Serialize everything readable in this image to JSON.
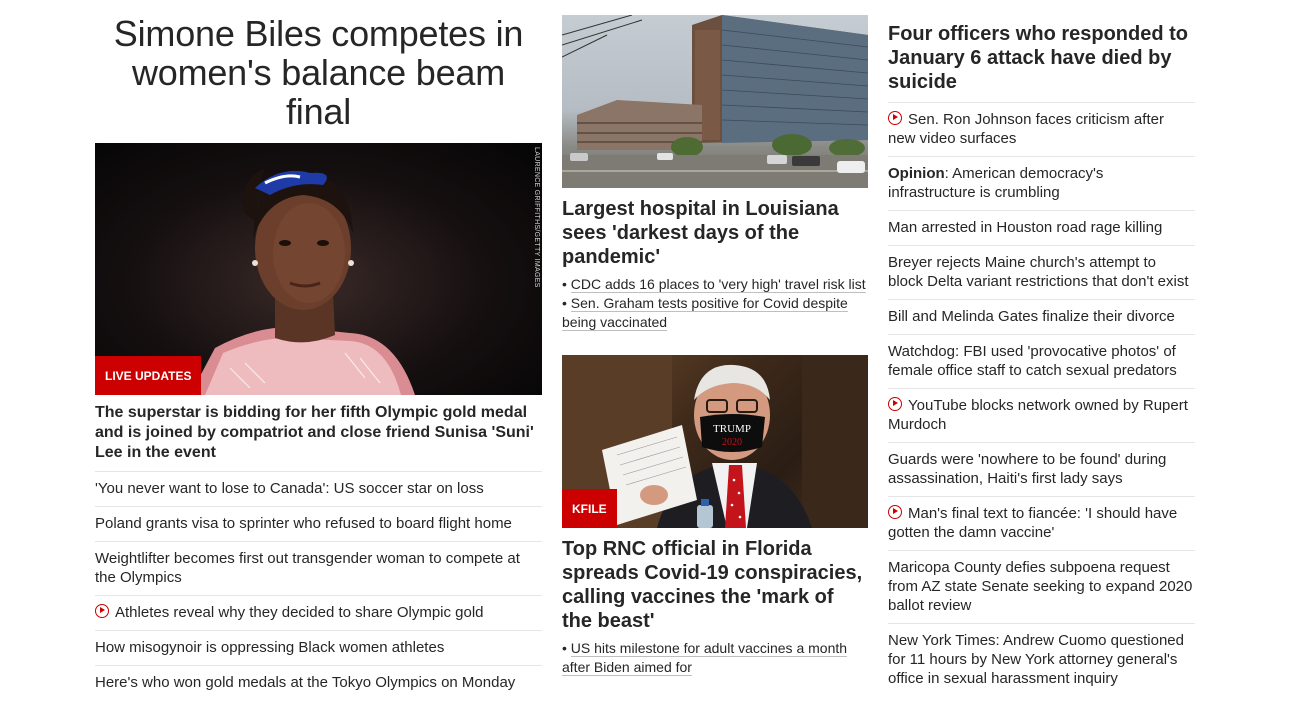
{
  "col1": {
    "title": "Simone Biles competes in women's balance beam final",
    "image_credit": "LAURENCE GRIFFITHS/GETTY IMAGES",
    "badge": "LIVE UPDATES",
    "subheadline": "The superstar is bidding for her fifth Olympic gold medal and is joined by compatriot and close friend Sunisa 'Suni' Lee in the event",
    "items": [
      {
        "text": "'You never want to lose to Canada': US soccer star on loss",
        "video": false
      },
      {
        "text": "Poland grants visa to sprinter who refused to board flight home",
        "video": false
      },
      {
        "text": "Weightlifter becomes first out transgender woman to compete at the Olympics",
        "video": false
      },
      {
        "text": "Athletes reveal why they decided to share Olympic gold",
        "video": true
      },
      {
        "text": "How misogynoir is oppressing Black women athletes",
        "video": false
      },
      {
        "text": "Here's who won gold medals at the Tokyo Olympics on Monday",
        "video": false
      }
    ]
  },
  "col2": {
    "story1": {
      "title": "Largest hospital in Louisiana sees 'darkest days of the pandemic'",
      "bullets": [
        "CDC adds 16 places to 'very high' travel risk list",
        "Sen. Graham tests positive for Covid despite being vaccinated"
      ]
    },
    "story2": {
      "badge": "KFILE",
      "mask_text_1": "TRUMP",
      "mask_text_2": "2020",
      "title": "Top RNC official in Florida spreads Covid-19 conspiracies, calling vaccines the 'mark of the beast'",
      "bullets": [
        "US hits milestone for adult vaccines a month after Biden aimed for"
      ]
    }
  },
  "col3": {
    "title": "Four officers who responded to January 6 attack have died by suicide",
    "items": [
      {
        "prefix": "",
        "text": "Sen. Ron Johnson faces criticism after new video surfaces",
        "video": true
      },
      {
        "prefix": "Opinion",
        "text": ": American democracy's infrastructure is crumbling",
        "video": false
      },
      {
        "prefix": "",
        "text": "Man arrested in Houston road rage killing",
        "video": false
      },
      {
        "prefix": "",
        "text": "Breyer rejects Maine church's attempt to block Delta variant restrictions that don't exist",
        "video": false
      },
      {
        "prefix": "",
        "text": "Bill and Melinda Gates finalize their divorce",
        "video": false
      },
      {
        "prefix": "",
        "text": "Watchdog: FBI used 'provocative photos' of female office staff to catch sexual predators",
        "video": false
      },
      {
        "prefix": "",
        "text": "YouTube blocks network owned by Rupert Murdoch",
        "video": true
      },
      {
        "prefix": "",
        "text": "Guards were 'nowhere to be found' during assassination, Haiti's first lady says",
        "video": false
      },
      {
        "prefix": "",
        "text": "Man's final text to fiancée: 'I should have gotten the damn vaccine'",
        "video": true
      },
      {
        "prefix": "",
        "text": "Maricopa County defies subpoena request from AZ state Senate seeking to expand 2020 ballot review",
        "video": false
      },
      {
        "prefix": "",
        "text": "New York Times: Andrew Cuomo questioned for 11 hours by New York attorney general's office in sexual harassment inquiry",
        "video": false
      }
    ]
  },
  "colors": {
    "accent_red": "#cc0000",
    "text": "#262626",
    "divider": "#e6e6e6"
  }
}
